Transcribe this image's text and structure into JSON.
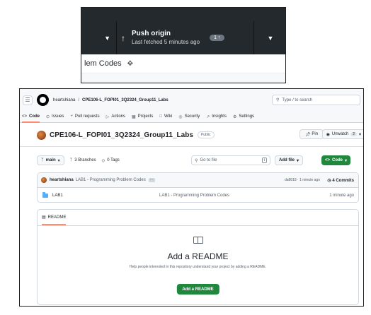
{
  "desktop": {
    "push_title": "Push origin",
    "push_subtitle": "Last fetched 5 minutes ago",
    "push_badge": "1 ↑",
    "changes_row_text": "lem Codes"
  },
  "github": {
    "breadcrumb": {
      "owner": "heartshiana",
      "separator": "/",
      "repo": "CPE106-L_FOPI01_3Q2324_Group11_Labs"
    },
    "search_placeholder": "Type / to search",
    "search_key": "/",
    "tabs": [
      {
        "icon": "<>",
        "label": "Code"
      },
      {
        "icon": "⊙",
        "label": "Issues"
      },
      {
        "icon": "⑂",
        "label": "Pull requests"
      },
      {
        "icon": "▷",
        "label": "Actions"
      },
      {
        "icon": "▦",
        "label": "Projects"
      },
      {
        "icon": "□",
        "label": "Wiki"
      },
      {
        "icon": "◎",
        "label": "Security"
      },
      {
        "icon": "↗",
        "label": "Insights"
      },
      {
        "icon": "⚙",
        "label": "Settings"
      }
    ],
    "repo_title": "CPE106-L_FOPI01_3Q2324_Group11_Labs",
    "visibility": "Public",
    "pin_label": "Pin",
    "unwatch_label": "Unwatch",
    "watch_count": "2",
    "branch": "main",
    "branches_label": "3 Branches",
    "tags_label": "0 Tags",
    "goto_placeholder": "Go to file",
    "goto_key": "t",
    "add_file_label": "Add file",
    "code_button_label": "Code",
    "latest_commit": {
      "author": "heartshiana",
      "message": "LAB1 - Programming Problem Codes",
      "meta": "da8818 · 1 minute ago",
      "commits": "4 Commits"
    },
    "files": [
      {
        "name": "LAB1",
        "message": "LAB1 - Programming Problem Codes",
        "time": "1 minute ago"
      }
    ],
    "readme": {
      "tab_label": "README",
      "title": "Add a README",
      "description": "Help people interested in this repository understand your project by adding a README.",
      "button_label": "Add a README"
    }
  }
}
